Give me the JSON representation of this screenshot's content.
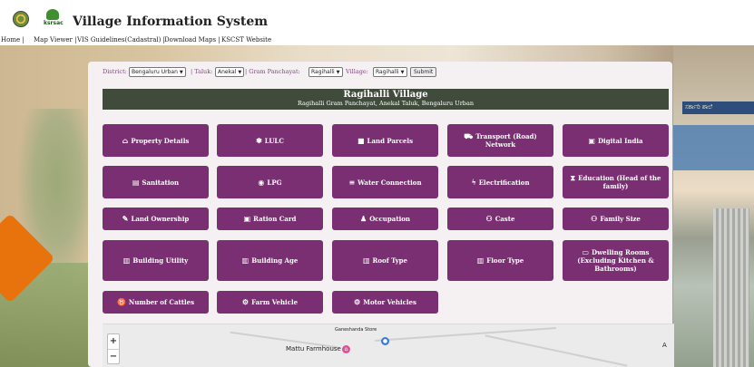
{
  "app": {
    "title": "Village Information System",
    "logo2_text": "ksrsac"
  },
  "nav": [
    "Home |",
    "Map Viewer |",
    "VIS Guidelines(Cadastral) |",
    "Download Maps |",
    "KSCST Website"
  ],
  "filters": {
    "district_label": "District:",
    "district_value": "Bengaluru Urban",
    "sep1": "| Taluk:",
    "taluk_value": "Anekal",
    "sep2": "| Gram Panchayat:",
    "gp_value": "Ragihalli",
    "sep3": "Village:",
    "village_value": "Ragihalli",
    "submit": "Submit"
  },
  "banner": {
    "title": "Ragihalli Village",
    "subtitle": "Ragihalli Gram Panchayat, Anekal Taluk, Bengaluru Urban"
  },
  "tiles": [
    {
      "label": "Property Details",
      "icon": "home-icon"
    },
    {
      "label": "LULC",
      "icon": "seedling-icon"
    },
    {
      "label": "Land Parcels",
      "icon": "square-icon"
    },
    {
      "label": "Transport (Road) Network",
      "icon": "truck-icon"
    },
    {
      "label": "Digital India",
      "icon": "id-card-icon"
    },
    {
      "label": "Sanitation",
      "icon": "toilet-icon"
    },
    {
      "label": "LPG",
      "icon": "fire-icon"
    },
    {
      "label": "Water Connection",
      "icon": "bars-icon"
    },
    {
      "label": "Electrification",
      "icon": "bolt-icon"
    },
    {
      "label": "Education (Head of the family)",
      "icon": "hourglass-icon"
    },
    {
      "label": "Land Ownership",
      "icon": "pencil-icon"
    },
    {
      "label": "Ration Card",
      "icon": "card-icon"
    },
    {
      "label": "Occupation",
      "icon": "person-icon"
    },
    {
      "label": "Caste",
      "icon": "users-icon"
    },
    {
      "label": "Family Size",
      "icon": "users-icon"
    },
    {
      "label": "Building Utility",
      "icon": "building-icon"
    },
    {
      "label": "Building Age",
      "icon": "building-icon"
    },
    {
      "label": "Roof Type",
      "icon": "building-icon"
    },
    {
      "label": "Floor Type",
      "icon": "building-icon"
    },
    {
      "label": "Dwelling Rooms (Excluding Kitchen & Bathrooms)",
      "icon": "bed-icon"
    },
    {
      "label": "Number of Cattles",
      "icon": "cow-icon"
    },
    {
      "label": "Farm Vehicle",
      "icon": "tractor-icon"
    },
    {
      "label": "Motor Vehicles",
      "icon": "motorcycle-icon"
    }
  ],
  "map": {
    "zoom_in": "+",
    "zoom_out": "−",
    "place1": "Mattu Farmhouse",
    "place2": "Ganeshanda Store",
    "edge_label": "A"
  },
  "right_photo": {
    "sign_text": "ಸರ್ಕಾರಿ ಶಾಲೆ"
  },
  "colors": {
    "tile": "#7a2f72",
    "banner": "#414b3c",
    "accent": "#e8720c"
  }
}
